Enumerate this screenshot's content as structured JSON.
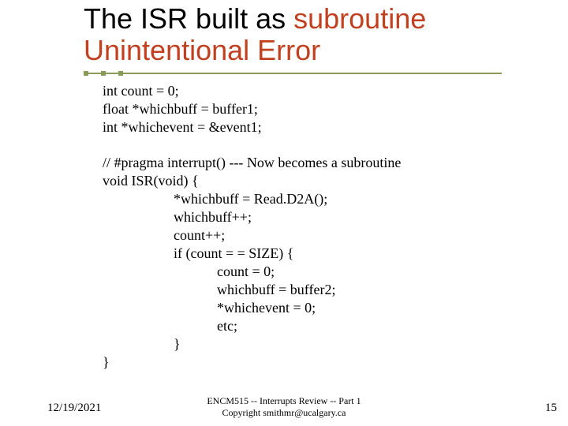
{
  "title": {
    "line1_a": "The ISR built as ",
    "line1_b": "subroutine",
    "line2": "Unintentional Error"
  },
  "code": {
    "l1": "int count = 0;",
    "l2": "float *whichbuff = buffer1;",
    "l3": "int *whichevent = &event1;",
    "l4": "// #pragma interrupt()  --- Now becomes a subroutine",
    "l5": "void ISR(void) {",
    "l6": "*whichbuff = Read.D2A();",
    "l7": "whichbuff++;",
    "l8": "count++;",
    "l9": "if (count = = SIZE) {",
    "l10": "count = 0;",
    "l11": "whichbuff = buffer2;",
    "l12": "*whichevent = 0;",
    "l13": "etc;",
    "l14": "}",
    "l15": "}"
  },
  "footer": {
    "date": "12/19/2021",
    "line1": "ENCM515 -- Interrupts Review -- Part 1",
    "line2": "Copyright smithmr@ucalgary.ca",
    "slide": "15"
  }
}
